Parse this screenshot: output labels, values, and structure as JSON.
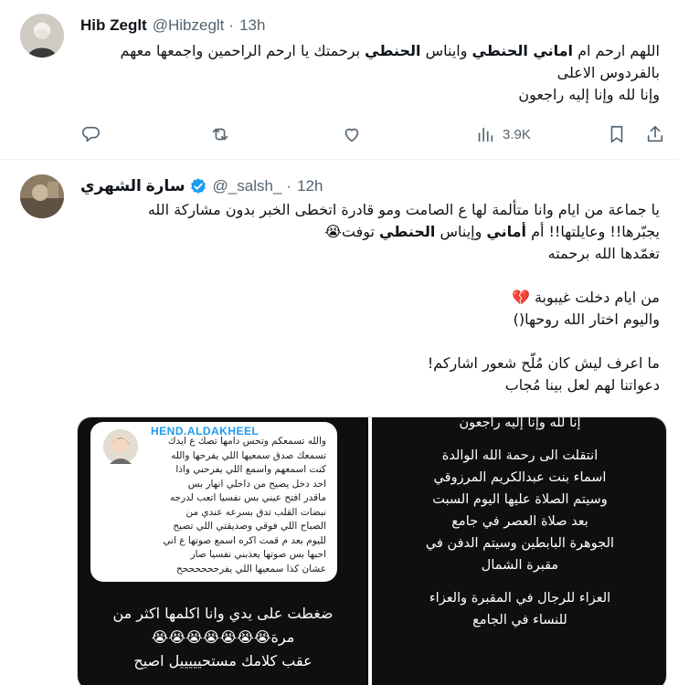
{
  "tweets": [
    {
      "name": "Hib Zeglt",
      "handle": "@Hibzeglt",
      "dot": "·",
      "time": "13h",
      "lines": [
        [
          "اللهم ارحم ام ",
          "اماني الحنطي",
          " وايناس ",
          "الحنطي",
          " برحمتك يا ارحم الراحمين واجمعها معهم"
        ],
        "بالفردوس الاعلى",
        "وإنا لله وإنا إليه راجعون"
      ],
      "actions": {
        "views": "3.9K"
      }
    },
    {
      "name": "سارة الشهري",
      "handle": "@_salsh_",
      "dot": "·",
      "time": "12h",
      "lines": [
        "يا جماعة من ايام وانا متألمة لها ع الصامت ومو قادرة اتخطى الخبر بدون مشاركة الله",
        [
          "يجبّرها!! وعايلتها!! أم ",
          "أماني",
          " وإيناس ",
          "الحنطي",
          " توفت😭"
        ],
        "تغمّدها الله برحمته",
        "",
        "من ايام دخلت غيبوبة 💔",
        "واليوم اختار الله روحها()",
        "",
        "ما اعرف ليش كان مُلّح شعور اشاركم!",
        "دعواتنا لهم لعل بينا مُجاب"
      ],
      "media": {
        "left": {
          "card_name": "HEND.ALDAKHEEL",
          "card_lines": [
            "والله تسمعكم وتحس دامها تصك ع ايدك",
            "تسمعك صدق سمعيها اللي يفرحها والله",
            "كنت اسمعهم واسمع اللي يفرحني واذا",
            "احد دخل يصيح من داخلي انهار بس",
            "ماقدر افتح عيني بس نفسيا اتعب لدرجه",
            "نبضات القلب تدق بسرعه عندي من",
            "الصباح اللي فوقي وصديقتي اللي تصيح",
            "لليوم بعد م قمت اكره اسمع صوتها ع اني",
            "احبها بس صوتها يعذبني نفسيا صار",
            "عشان كذا سمعيها اللي يفرححححححح"
          ],
          "text_lines": [
            "ضغطت على يدي وانا اكلمها اكثر من",
            "مرة😭😭😭😭😭😭😭",
            "عقب كلامك مستحيييييل اصيح"
          ]
        },
        "right": {
          "text_lines": [
            "إنا لله وإنا إليه راجعون",
            "",
            "انتقلت الى رحمة الله الوالدة",
            "اسماء بنت عبدالكريم المرزوقي",
            "وسيتم الصلاة عليها اليوم السبت",
            "بعد صلاة العصر في جامع",
            "الجوهرة البابطين وسيتم الدفن في",
            "مقبرة الشمال",
            "",
            "العزاء للرجال في المقبرة والعزاء",
            "للنساء في الجامع"
          ]
        }
      }
    }
  ],
  "colors": {
    "accent": "#1d9bf0",
    "text": "#0f1419",
    "muted": "#536471"
  },
  "icons": [
    "reply-icon",
    "retweet-icon",
    "like-icon",
    "views-icon",
    "bookmark-icon",
    "share-icon",
    "verified-badge-icon"
  ]
}
